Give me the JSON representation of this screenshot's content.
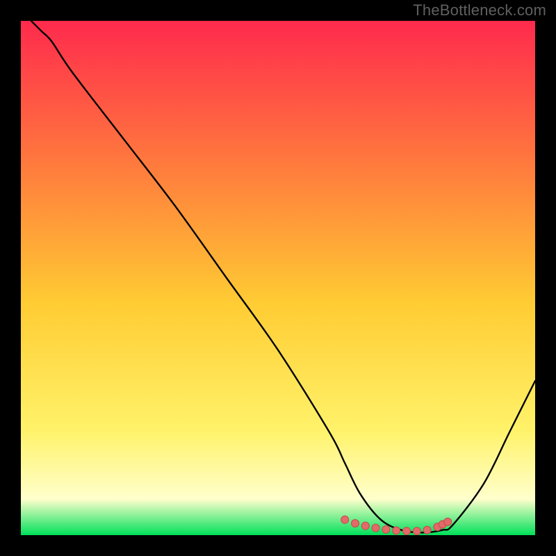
{
  "watermark": "TheBottleneck.com",
  "colors": {
    "frame": "#000000",
    "grad_top": "#ff2a4d",
    "grad_mid_upper": "#ff7a3d",
    "grad_mid": "#ffcc33",
    "grad_lower": "#fff36b",
    "grad_pale": "#ffffcc",
    "grad_bottom": "#00e05a",
    "curve": "#000000",
    "marker_fill": "#e46a6a",
    "marker_stroke": "#c44a4a"
  },
  "chart_data": {
    "type": "line",
    "title": "",
    "xlabel": "",
    "ylabel": "",
    "xlim": [
      0,
      100
    ],
    "ylim": [
      0,
      100
    ],
    "grid": false,
    "series": [
      {
        "name": "bottleneck-curve",
        "x": [
          2,
          4,
          6,
          10,
          20,
          30,
          40,
          50,
          60,
          63,
          66,
          70,
          74,
          78,
          82,
          84,
          90,
          95,
          100
        ],
        "y": [
          100,
          98,
          96,
          90,
          77,
          64,
          50,
          36,
          20,
          14,
          8,
          3,
          1,
          0.5,
          1,
          2,
          10,
          20,
          30
        ]
      }
    ],
    "markers": {
      "name": "flat-valley-markers",
      "x": [
        63,
        65,
        67,
        69,
        71,
        73,
        75,
        77,
        79,
        81,
        82,
        83
      ],
      "y": [
        3,
        2.3,
        1.8,
        1.4,
        1.1,
        0.9,
        0.8,
        0.8,
        1.0,
        1.6,
        2.1,
        2.6
      ]
    }
  }
}
